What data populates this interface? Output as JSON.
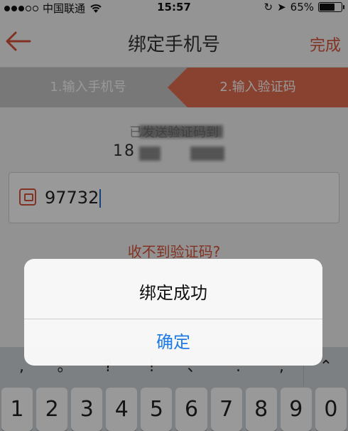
{
  "status_bar": {
    "carrier": "中国联通",
    "time": "15:57",
    "battery_percent": "65%",
    "battery_level": 0.65
  },
  "nav": {
    "title": "绑定手机号",
    "done_label": "完成",
    "back_icon": "arrow-left-icon"
  },
  "steps": {
    "step1": "1.输入手机号",
    "step2": "2.输入验证码",
    "active": 2
  },
  "content": {
    "sent_to_label": "已发送验证码到",
    "phone_partial": "18",
    "code_value": "97732",
    "resend_link": "收不到验证码?"
  },
  "alert": {
    "message": "绑定成功",
    "confirm_label": "确定"
  },
  "keyboard": {
    "punct_keys": [
      ",",
      "。",
      "?",
      "!",
      "、",
      ".",
      ","
    ],
    "number_keys": [
      "1",
      "2",
      "3",
      "4",
      "5",
      "6",
      "7",
      "8",
      "9",
      "0"
    ]
  },
  "colors": {
    "accent": "#d9533b",
    "step_active": "#e56e50",
    "step_inactive": "#c9c9c9",
    "link_blue": "#1e7be6"
  }
}
